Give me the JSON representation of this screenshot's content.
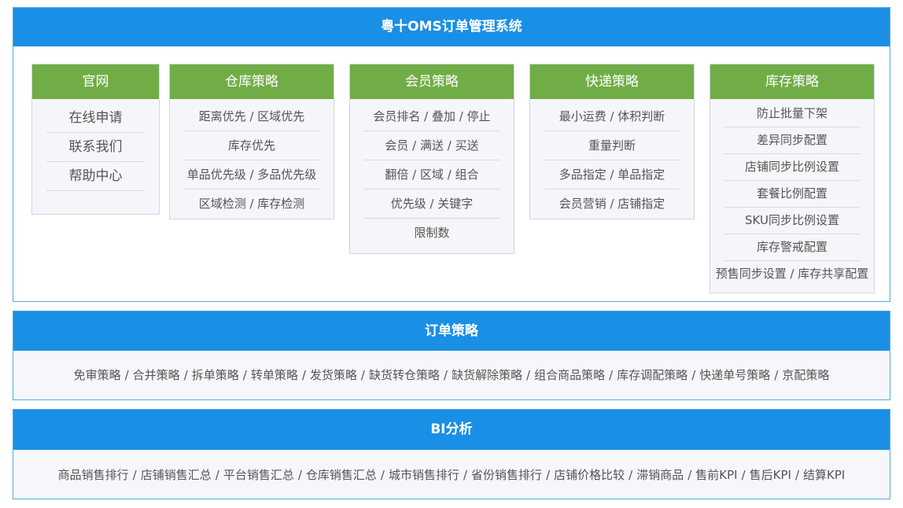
{
  "header_panel": {
    "title": "粤十OMS订单管理系统",
    "cards": [
      {
        "title": "官网",
        "items": [
          "在线申请",
          "联系我们",
          "帮助中心",
          ""
        ]
      },
      {
        "title": "仓库策略",
        "items": [
          "距离优先 / 区域优先",
          "库存优先",
          "单品优先级 / 多品优先级",
          "区域检测 / 库存检测"
        ]
      },
      {
        "title": "会员策略",
        "items": [
          "会员排名 / 叠加 / 停止",
          "会员 / 满送 / 买送",
          "翻倍 / 区域 / 组合",
          "优先级 / 关键字",
          "限制数"
        ]
      },
      {
        "title": "快递策略",
        "items": [
          "最小运费 / 体积判断",
          "重量判断",
          "多品指定 / 单品指定",
          "会员营销 / 店铺指定"
        ]
      },
      {
        "title": "库存策略",
        "items": [
          "防止批量下架",
          "差异同步配置",
          "店铺同步比例设置",
          "套餐比例配置",
          "SKU同步比例设置",
          "库存警戒配置",
          "预售同步设置 / 库存共享配置"
        ]
      }
    ]
  },
  "order_panel": {
    "title": "订单策略",
    "items": [
      "免审策略",
      "合并策略",
      "拆单策略",
      "转单策略",
      "发货策略",
      "缺货转仓策略",
      "缺货解除策略",
      "组合商品策略",
      "库存调配策略",
      "快递单号策略",
      "京配策略"
    ],
    "separator": "/"
  },
  "bi_panel": {
    "title": "BI分析",
    "items": [
      "商品销售排行",
      "店铺销售汇总",
      "平台销售汇总",
      "仓库销售汇总",
      "城市销售排行",
      "省份销售排行",
      "店铺价格比较",
      "滞销商品",
      "售前KPI",
      "售后KPI",
      "结算KPI"
    ],
    "separator": "/"
  },
  "colors": {
    "panel_header": "#1a8fe6",
    "card_header": "#71ad47",
    "card_body": "#f5f6fa",
    "panel_border": "#55a9e2"
  }
}
